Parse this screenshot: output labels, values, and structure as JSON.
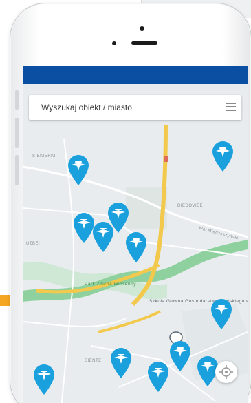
{
  "search": {
    "placeholder": "Wyszukaj obiekt / miasto",
    "menu_icon": "hamburger-menu-icon"
  },
  "map": {
    "labels": [
      "SIEKIERKI",
      "DIEDOVIEE",
      "UZBEI",
      "SIENTE",
      "Wal Miedzeszyński"
    ],
    "park_label": "Park Znicha Wiosenny",
    "poi_label": "Szkoła Główna Gospodarstwa Wiejskiego w Warszawie",
    "pin_icon": "aircraft-pin-icon",
    "locate_icon": "crosshair-locate-icon"
  },
  "colors": {
    "accent": "#f5a623",
    "status_bar": "#0b4fa2",
    "pin": "#1aa0dc",
    "highway": "#f2c94c",
    "river": "#8fd19e"
  }
}
